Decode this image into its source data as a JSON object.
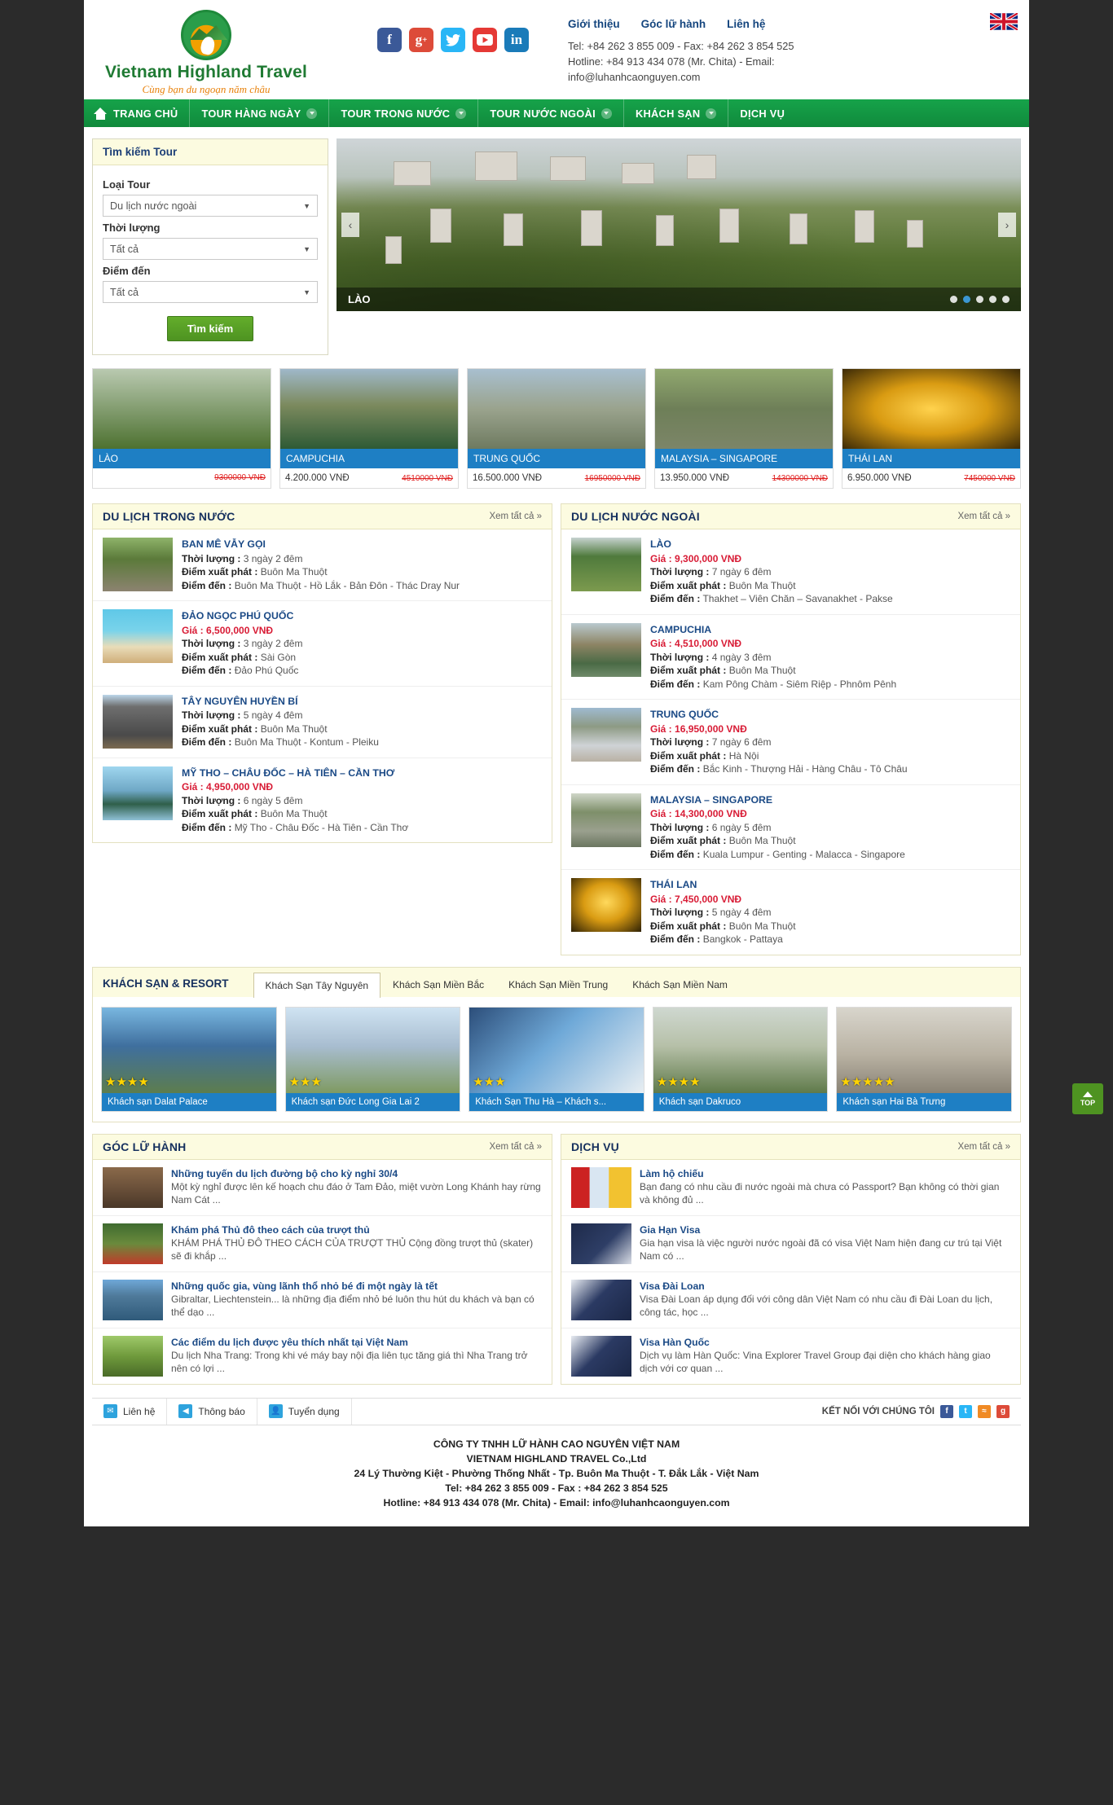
{
  "brand": {
    "name": "Vietnam Highland Travel",
    "slogan": "Cùng bạn du ngoạn năm châu"
  },
  "header": {
    "top_links": [
      "Giới thiệu",
      "Góc lữ hành",
      "Liên hệ"
    ],
    "tel_line": "Tel: +84 262 3 855 009 - Fax: +84 262 3 854 525",
    "hotline_line": "Hotline: +84 913 434 078 (Mr. Chita) - Email:",
    "email_line": "info@luhanhcaonguyen.com",
    "social": [
      "facebook-icon",
      "google-plus-icon",
      "twitter-icon",
      "youtube-icon",
      "linkedin-icon"
    ],
    "flag": "uk-flag-icon"
  },
  "nav": [
    {
      "label": "TRANG CHỦ",
      "caret": false,
      "home": true
    },
    {
      "label": "TOUR HÀNG NGÀY",
      "caret": true,
      "home": false
    },
    {
      "label": "TOUR TRONG NƯỚC",
      "caret": true,
      "home": false
    },
    {
      "label": "TOUR NƯỚC NGOÀI",
      "caret": true,
      "home": false
    },
    {
      "label": "KHÁCH SẠN",
      "caret": true,
      "home": false
    },
    {
      "label": "DỊCH VỤ",
      "caret": false,
      "home": false
    }
  ],
  "search": {
    "title": "Tìm kiếm Tour",
    "fields": [
      {
        "label": "Loại Tour",
        "value": "Du lịch nước ngoài"
      },
      {
        "label": "Thời lượng",
        "value": "Tất cả"
      },
      {
        "label": "Điểm đến",
        "value": "Tất cả"
      }
    ],
    "button": "Tìm kiếm"
  },
  "slider": {
    "caption": "LÀO",
    "dots": 5,
    "active_dot": 2,
    "prev": "‹",
    "next": "›"
  },
  "featured": [
    {
      "name": "LÀO",
      "price": "",
      "old_price": "9300000 VNĐ"
    },
    {
      "name": "CAMPUCHIA",
      "price": "4.200.000 VNĐ",
      "old_price": "4510000 VNĐ"
    },
    {
      "name": "TRUNG QUỐC",
      "price": "16.500.000 VNĐ",
      "old_price": "16950000 VNĐ"
    },
    {
      "name": "MALAYSIA – SINGAPORE",
      "price": "13.950.000 VNĐ",
      "old_price": "14300000 VNĐ"
    },
    {
      "name": "THÁI LAN",
      "price": "6.950.000 VNĐ",
      "old_price": "7450000 VNĐ"
    }
  ],
  "domestic": {
    "title": "DU LỊCH TRONG NƯỚC",
    "see_all": "Xem tất cả »",
    "labels": {
      "price": "Giá :",
      "duration": "Thời lượng :",
      "departure": "Điểm xuất phát :",
      "destination": "Điểm đến :"
    },
    "items": [
      {
        "title": "BAN MÊ VẪY GỌI",
        "price": "",
        "duration": "3 ngày 2 đêm",
        "departure": "Buôn Ma Thuột",
        "destination": "Buôn Ma Thuột - Hồ Lắk - Bản Đôn - Thác Dray Nur"
      },
      {
        "title": "ĐẢO NGỌC PHÚ QUỐC",
        "price": "6,500,000 VNĐ",
        "duration": "3 ngày 2 đêm",
        "departure": "Sài Gòn",
        "destination": "Đảo Phú Quốc"
      },
      {
        "title": "TÂY NGUYÊN HUYỀN BÍ",
        "price": "",
        "duration": "5 ngày 4 đêm",
        "departure": "Buôn Ma Thuột",
        "destination": "Buôn Ma Thuột - Kontum - Pleiku"
      },
      {
        "title": "MỸ THO – CHÂU ĐỐC – HÀ TIÊN – CẦN THƠ",
        "price": "4,950,000 VNĐ",
        "duration": "6 ngày 5 đêm",
        "departure": "Buôn Ma Thuột",
        "destination": "Mỹ Tho - Châu Đốc - Hà Tiên - Cần Thơ"
      }
    ]
  },
  "international": {
    "title": "DU LỊCH NƯỚC NGOÀI",
    "see_all": "Xem tất cả »",
    "items": [
      {
        "title": "LÀO",
        "price": "9,300,000 VNĐ",
        "duration": "7 ngày 6 đêm",
        "departure": "Buôn Ma Thuột",
        "destination": "Thakhet – Viên Chăn – Savanakhet - Pakse"
      },
      {
        "title": "CAMPUCHIA",
        "price": "4,510,000 VNĐ",
        "duration": "4 ngày 3 đêm",
        "departure": "Buôn Ma Thuột",
        "destination": "Kam Pông Chàm - Siêm Riệp - Phnôm Pênh"
      },
      {
        "title": "TRUNG QUỐC",
        "price": "16,950,000 VNĐ",
        "duration": "7 ngày 6 đêm",
        "departure": "Hà Nội",
        "destination": "Bắc Kinh - Thượng Hải - Hàng Châu - Tô Châu"
      },
      {
        "title": "MALAYSIA – SINGAPORE",
        "price": "14,300,000 VNĐ",
        "duration": "6 ngày 5 đêm",
        "departure": "Buôn Ma Thuột",
        "destination": "Kuala Lumpur - Genting - Malacca - Singapore"
      },
      {
        "title": "THÁI LAN",
        "price": "7,450,000 VNĐ",
        "duration": "5 ngày 4 đêm",
        "departure": "Buôn Ma Thuột",
        "destination": "Bangkok - Pattaya"
      }
    ]
  },
  "hotels": {
    "title": "KHÁCH SẠN & RESORT",
    "tabs": [
      "Khách Sạn Tây Nguyên",
      "Khách Sạn Miền Bắc",
      "Khách Sạn Miền Trung",
      "Khách Sạn Miền Nam"
    ],
    "active_tab": 0,
    "items": [
      {
        "name": "Khách sạn Dalat Palace",
        "stars": 4
      },
      {
        "name": "Khách sạn Đức Long Gia Lai 2",
        "stars": 3
      },
      {
        "name": "Khách Sạn Thu Hà – Khách s...",
        "stars": 3
      },
      {
        "name": "Khách sạn Dakruco",
        "stars": 4
      },
      {
        "name": "Khách sạn Hai Bà Trưng",
        "stars": 5
      }
    ]
  },
  "travel_corner": {
    "title": "GÓC LỮ HÀNH",
    "see_all": "Xem tất cả »",
    "items": [
      {
        "title": "Những tuyến du lịch đường bộ cho kỳ nghỉ 30/4",
        "desc": "Một kỳ nghỉ được lên kế hoạch chu đáo ở Tam Đảo, miệt vườn Long Khánh hay rừng Nam Cát ..."
      },
      {
        "title": "Khám phá Thủ đô theo cách của trượt thủ",
        "desc": "KHÁM PHÁ THỦ ĐÔ THEO CÁCH CỦA TRƯỢT THỦ Cộng đồng trượt thủ (skater) sẽ đi khắp ..."
      },
      {
        "title": "Những quốc gia, vùng lãnh thổ nhỏ bé đi một ngày là tết",
        "desc": "Gibraltar, Liechtenstein... là những địa điểm nhỏ bé luôn thu hút du khách và bạn có thể dạo ..."
      },
      {
        "title": "Các điểm du lịch được yêu thích nhất tại Việt Nam",
        "desc": "Du lịch Nha Trang: Trong khi vé máy bay nội địa liên tục tăng giá thì Nha Trang trở nên có lợi ..."
      }
    ]
  },
  "services": {
    "title": "DỊCH VỤ",
    "see_all": "Xem tất cả »",
    "items": [
      {
        "title": "Làm hộ chiếu",
        "desc": "Bạn đang có nhu cầu đi nước ngoài mà chưa có Passport? Bạn không có thời gian và không đủ ..."
      },
      {
        "title": "Gia Hạn Visa",
        "desc": "Gia hạn visa là việc người nước ngoài đã có visa Việt Nam hiện đang cư trú tại Việt Nam có ..."
      },
      {
        "title": "Visa Đài Loan",
        "desc": "Visa Đài Loan áp dụng đối với công dân Việt Nam có nhu cầu đi Đài Loan du lịch, công tác, học ..."
      },
      {
        "title": "Visa Hàn Quốc",
        "desc": "Dịch vụ làm Hàn Quốc:  Vina Explorer Travel Group đại diện cho khách hàng giao dịch với cơ quan ..."
      }
    ]
  },
  "footbar": {
    "items": [
      "Liên hệ",
      "Thông báo",
      "Tuyển dụng"
    ],
    "connect_label": "KẾT NỐI VỚI CHÚNG TÔI",
    "socials": [
      "facebook-icon",
      "twitter-icon",
      "rss-icon",
      "google-plus-icon"
    ]
  },
  "footer": {
    "line1": "CÔNG TY TNHH LỮ HÀNH CAO NGUYÊN VIỆT NAM",
    "line2": "VIETNAM HIGHLAND TRAVEL Co.,Ltd",
    "line3": "24 Lý Thường Kiệt - Phường Thống Nhất - Tp. Buôn Ma Thuột - T. Đắk Lắk - Việt Nam",
    "line4": "Tel: +84 262 3 855 009 - Fax : +84 262 3 854 525",
    "line5": "Hotline: +84 913 434 078 (Mr. Chita) - Email: info@luhanhcaonguyen.com"
  },
  "top_button": {
    "label": "TOP"
  }
}
